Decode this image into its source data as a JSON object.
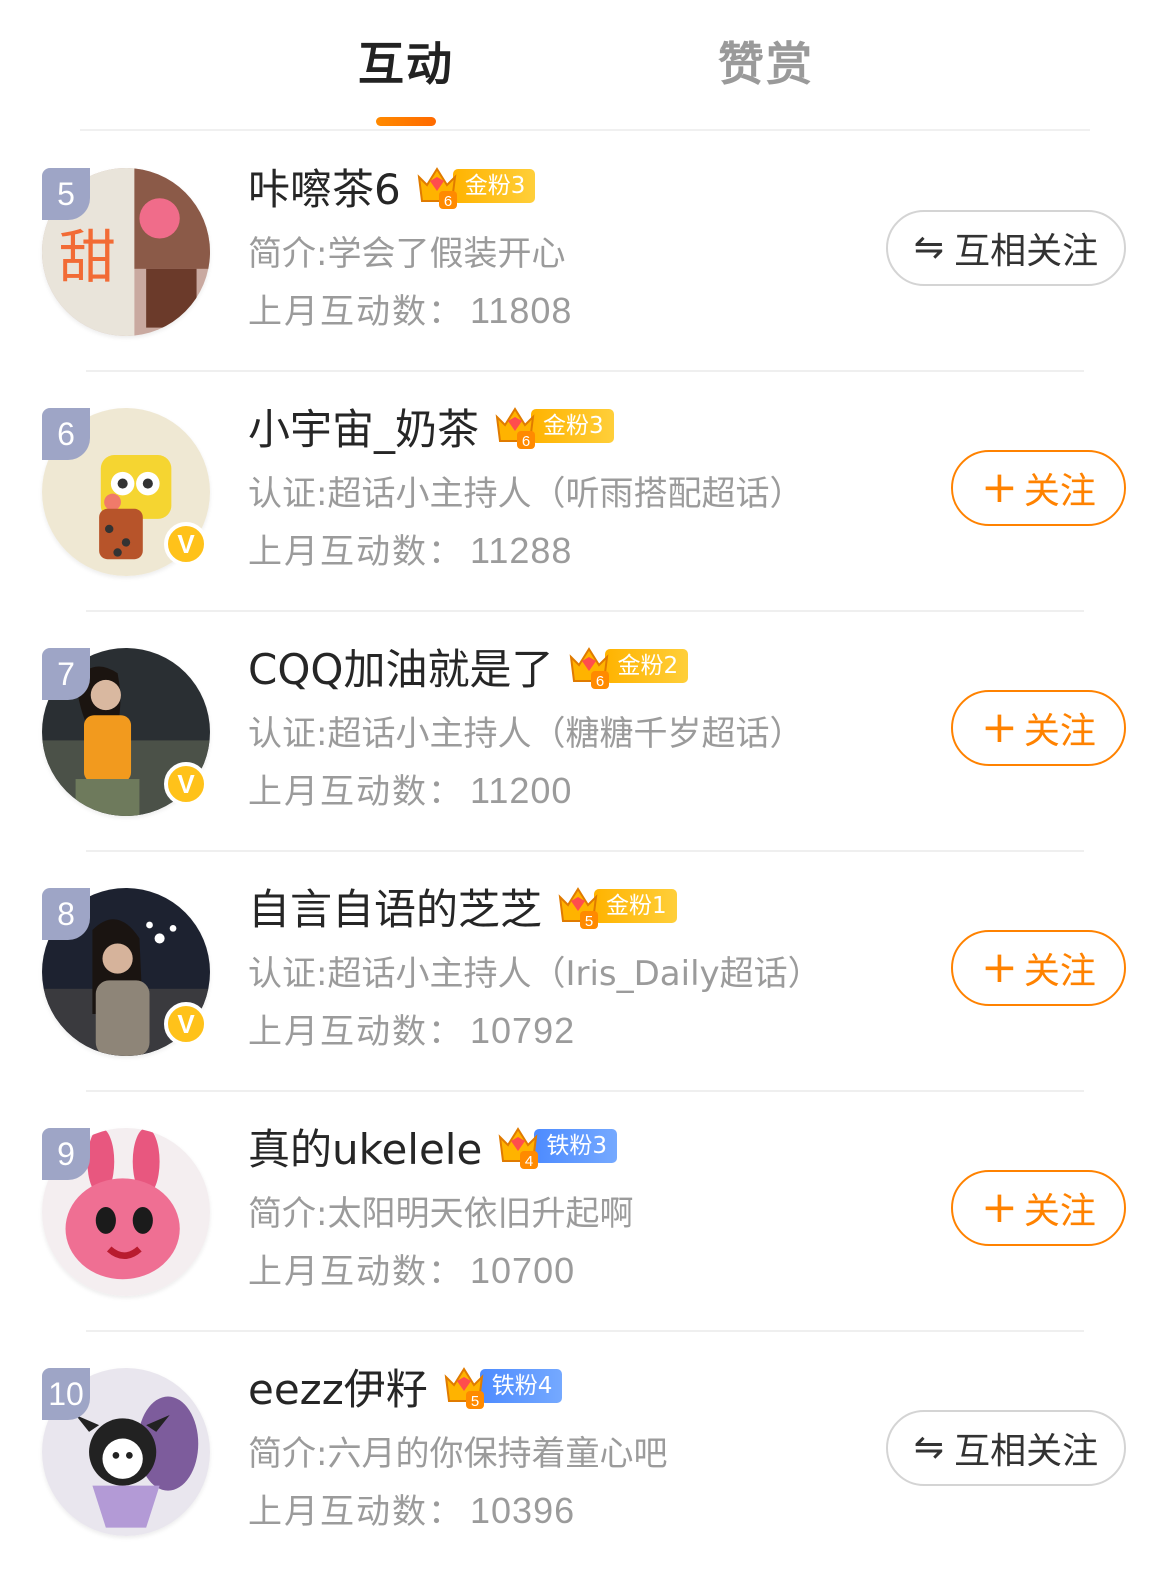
{
  "tabs": {
    "interaction": "互动",
    "reward": "赞赏"
  },
  "colors": {
    "accent": "#ff8200",
    "gold_badge": "#ffb300",
    "iron_badge": "#4d8bff",
    "rank_badge": "#9ea5c6",
    "verified": "#ffc21a"
  },
  "users": [
    {
      "rank": "5",
      "name": "咔嚓茶6",
      "badge_level": "6",
      "badge_label": "金粉3",
      "badge_type": "gold",
      "desc": "简介:学会了假装开心",
      "stat_label": "上月互动数：",
      "stat_value": "11808",
      "verified": false,
      "button_icon": "⇋",
      "button_label": "互相关注",
      "button_type": "mutual"
    },
    {
      "rank": "6",
      "name": "小宇宙_奶茶",
      "badge_level": "6",
      "badge_label": "金粉3",
      "badge_type": "gold",
      "desc": "认证:超话小主持人（听雨搭配超话）",
      "stat_label": "上月互动数：",
      "stat_value": "11288",
      "verified": true,
      "verified_mark": "V",
      "button_icon": "+",
      "button_label": "关注",
      "button_type": "follow"
    },
    {
      "rank": "7",
      "name": "CQQ加油就是了",
      "badge_level": "6",
      "badge_label": "金粉2",
      "badge_type": "gold",
      "desc": "认证:超话小主持人（糖糖千岁超话）",
      "stat_label": "上月互动数：",
      "stat_value": "11200",
      "verified": true,
      "verified_mark": "V",
      "button_icon": "+",
      "button_label": "关注",
      "button_type": "follow"
    },
    {
      "rank": "8",
      "name": "自言自语的芝芝",
      "badge_level": "5",
      "badge_label": "金粉1",
      "badge_type": "gold",
      "desc": "认证:超话小主持人（Iris_Daily超话）",
      "stat_label": "上月互动数：",
      "stat_value": "10792",
      "verified": true,
      "verified_mark": "V",
      "button_icon": "+",
      "button_label": "关注",
      "button_type": "follow"
    },
    {
      "rank": "9",
      "name": "真的ukelele",
      "badge_level": "4",
      "badge_label": "铁粉3",
      "badge_type": "iron",
      "desc": "简介:太阳明天依旧升起啊",
      "stat_label": "上月互动数：",
      "stat_value": "10700",
      "verified": false,
      "button_icon": "+",
      "button_label": "关注",
      "button_type": "follow"
    },
    {
      "rank": "10",
      "name": "eezz伊籽",
      "badge_level": "5",
      "badge_label": "铁粉4",
      "badge_type": "iron",
      "desc": "简介:六月的你保持着童心吧",
      "stat_label": "上月互动数：",
      "stat_value": "10396",
      "verified": false,
      "button_icon": "⇋",
      "button_label": "互相关注",
      "button_type": "mutual"
    }
  ]
}
